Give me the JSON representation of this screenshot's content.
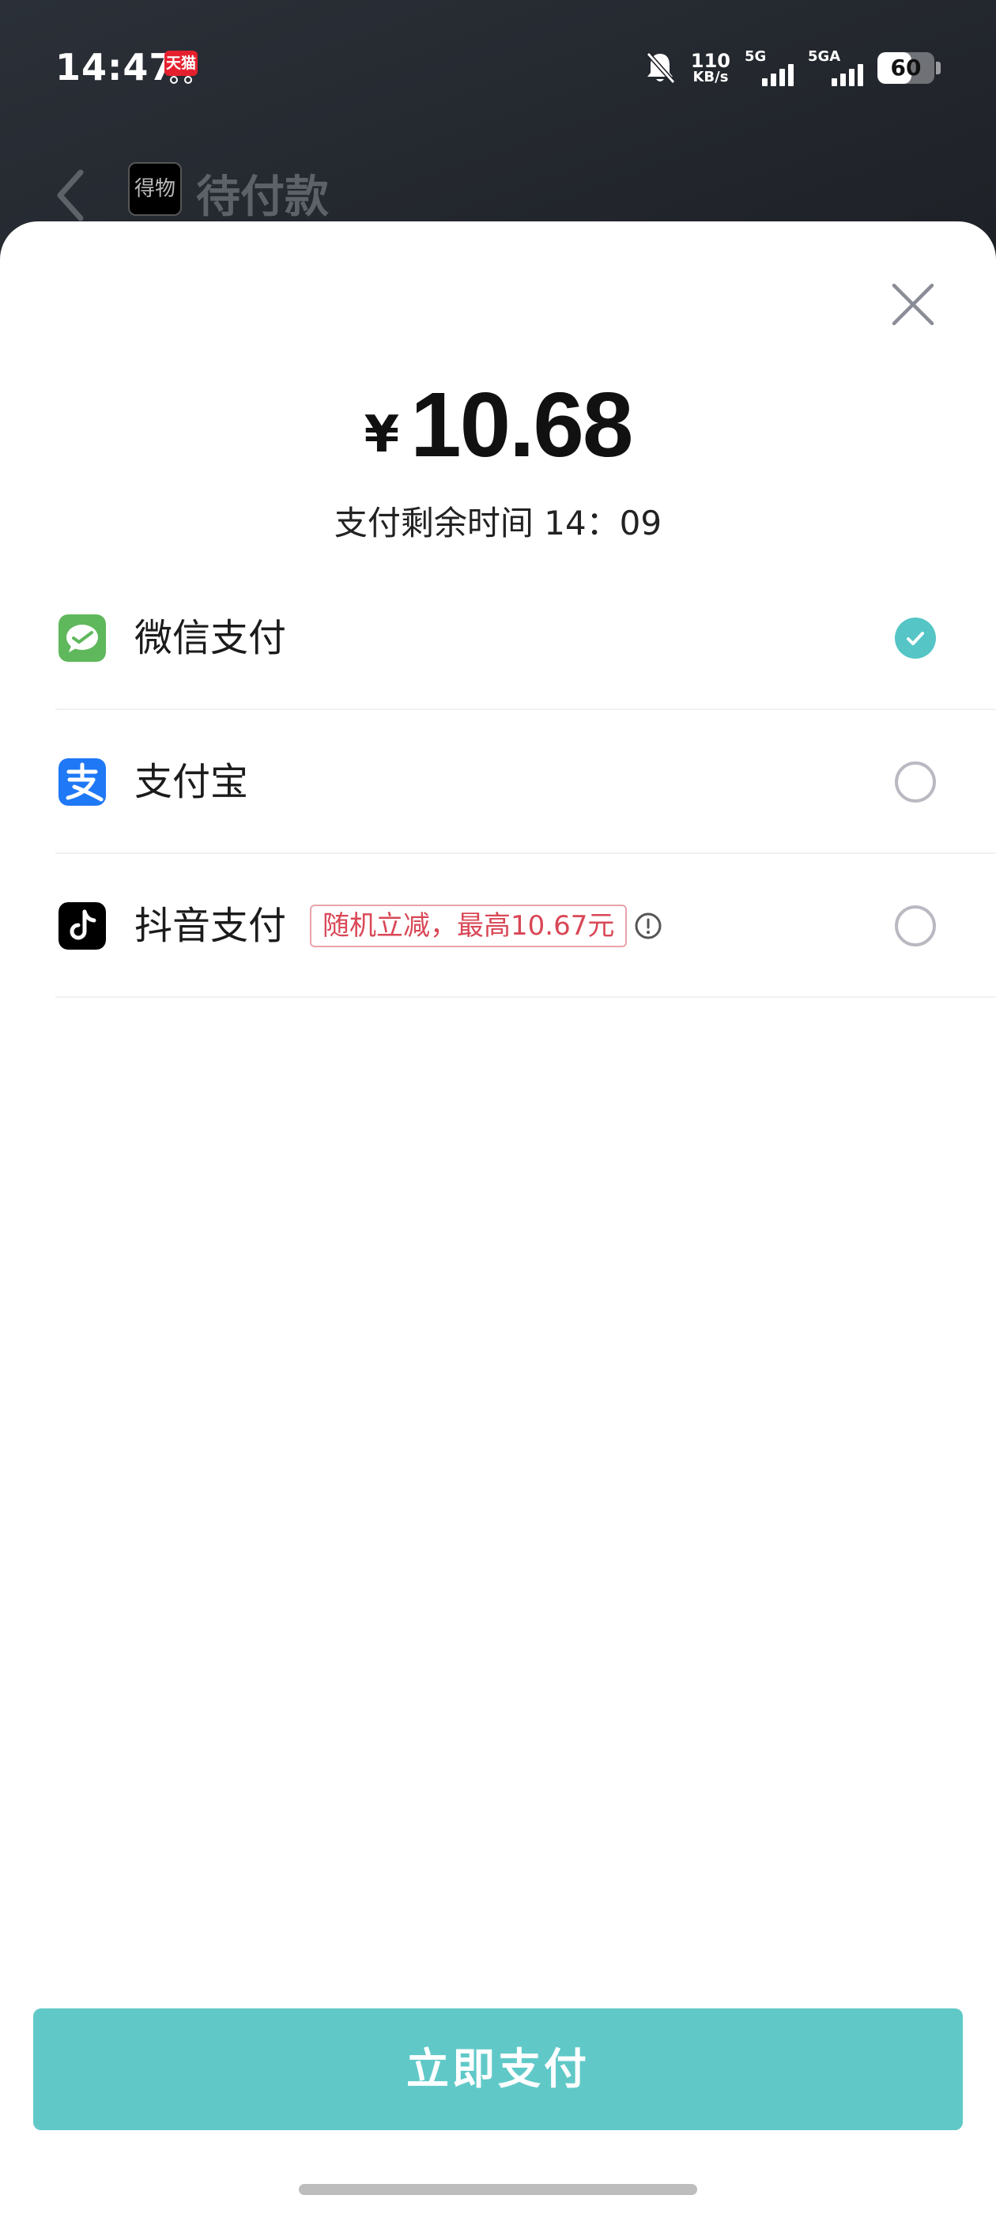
{
  "status_bar": {
    "time": "14:47",
    "tmall_badge": "天猫",
    "net_speed": "110",
    "net_speed_unit": "KB/s",
    "sim1_label": "5G",
    "sim2_label": "5GA",
    "battery_level": "60"
  },
  "background_page": {
    "logo_text": "得物",
    "title": "待付款"
  },
  "payment_sheet": {
    "currency_symbol": "¥",
    "amount": "10.68",
    "countdown": "支付剩余时间 14：09",
    "methods": [
      {
        "label": "微信支付",
        "icon": "wechat-pay-icon",
        "selected": true,
        "color": "#5fb85c"
      },
      {
        "label": "支付宝",
        "icon": "alipay-icon",
        "selected": false,
        "color": "#1f78f5"
      },
      {
        "label": "抖音支付",
        "icon": "douyin-pay-icon",
        "selected": false,
        "color": "#000000",
        "promo": "随机立减，最高10.67元"
      }
    ],
    "pay_button": "立即支付"
  },
  "colors": {
    "accent": "#5fc8c7",
    "promo": "#d94756"
  }
}
